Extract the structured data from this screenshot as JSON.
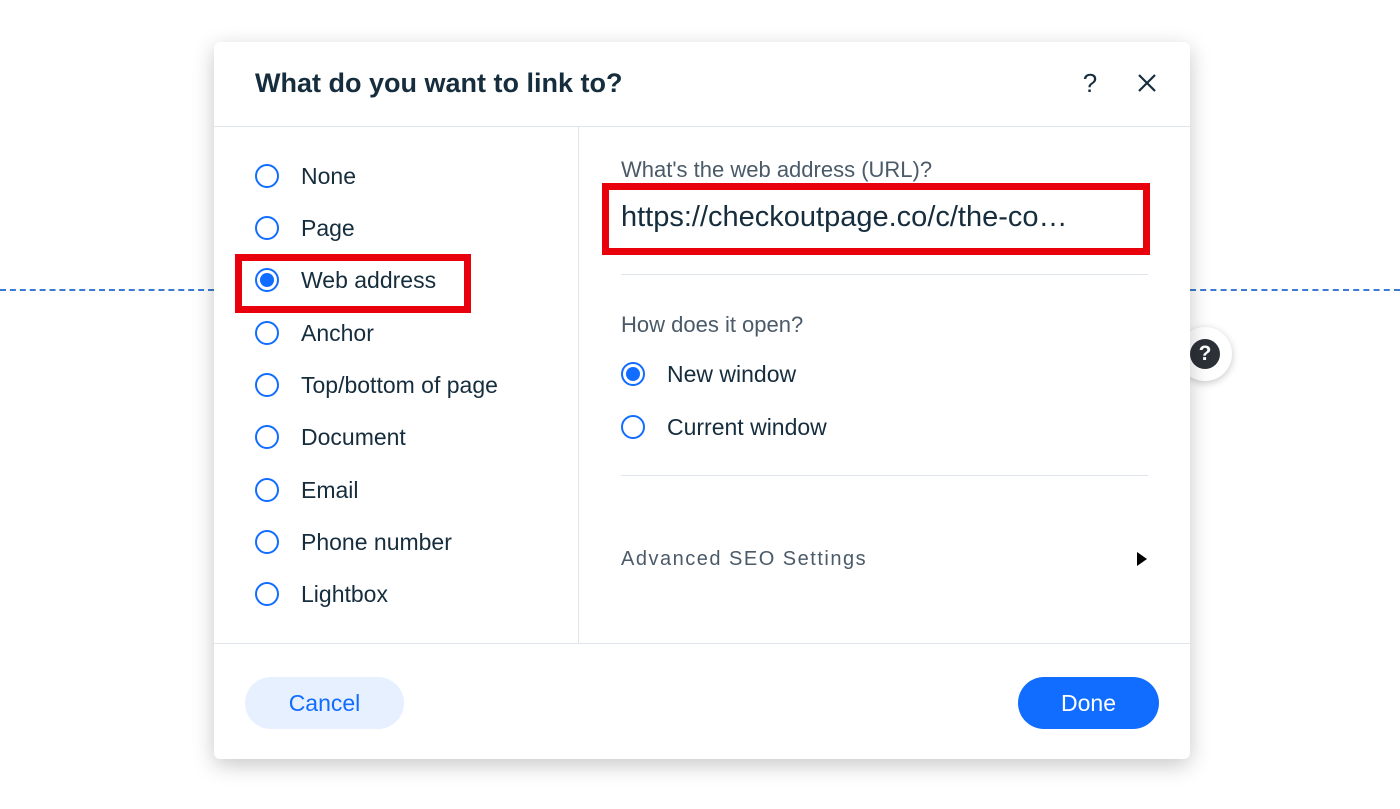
{
  "dialog": {
    "title": "What do you want to link to?",
    "help_symbol": "?",
    "help_icon": "question-mark-icon",
    "close_icon": "close-icon"
  },
  "link_types": {
    "items": [
      {
        "label": "None",
        "checked": false
      },
      {
        "label": "Page",
        "checked": false
      },
      {
        "label": "Web address",
        "checked": true
      },
      {
        "label": "Anchor",
        "checked": false
      },
      {
        "label": "Top/bottom of page",
        "checked": false
      },
      {
        "label": "Document",
        "checked": false
      },
      {
        "label": "Email",
        "checked": false
      },
      {
        "label": "Phone number",
        "checked": false
      },
      {
        "label": "Lightbox",
        "checked": false
      }
    ]
  },
  "web_address": {
    "url_label": "What's the web address (URL)?",
    "url_value": "https://checkoutpage.co/c/the-co…",
    "open_label": "How does it open?",
    "open_options": [
      {
        "label": "New window",
        "checked": true
      },
      {
        "label": "Current window",
        "checked": false
      }
    ],
    "advanced_seo_label": "Advanced SEO Settings",
    "advanced_seo_icon": "triangle-right-icon"
  },
  "footer": {
    "cancel_label": "Cancel",
    "done_label": "Done"
  },
  "background": {
    "help_bubble_symbol": "?"
  },
  "colors": {
    "accent": "#116dff",
    "highlight": "#e8000d",
    "title_text": "#162d3d",
    "secondary_text": "#4a5a68",
    "cancel_bg": "#e7f0ff"
  }
}
